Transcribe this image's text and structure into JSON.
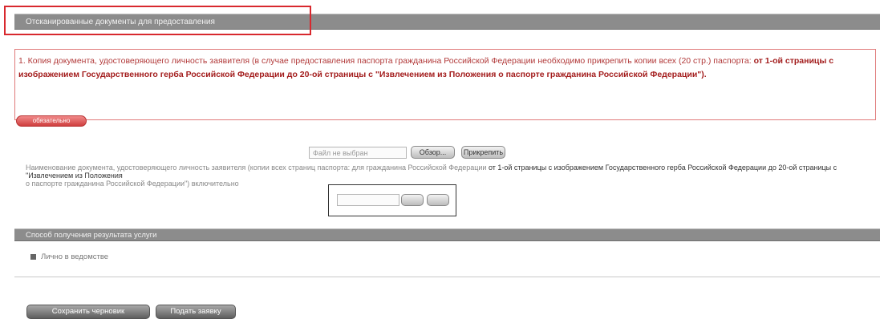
{
  "section1": {
    "title": "Отсканированные документы для предоставления"
  },
  "notice": {
    "prefix": "1. Копия документа, удостоверяющего личность заявителя (в случае предоставления паспорта гражданина Российской Федерации необходимо прикрепить копии всех (20 стр.) паспорта:",
    "bold": "от 1-ой страницы с изображением Государственного герба Российской Федерации до 20-ой страницы с \"Извлечением из Положения о паспорте гражданина Российской Федерации\")."
  },
  "required_label": "обязательно",
  "upload1": {
    "placeholder": "Файл не выбран",
    "browse_label": "Обзор...",
    "attach_label": "Прикрепить"
  },
  "desc": {
    "line1": "Наименование документа, удостоверяющего личность заявителя (копии всех страниц паспорта: для гражданина Российской Федерации",
    "line1_bold": "от 1-ой страницы с изображением Государственного герба Российской Федерации до 20-ой страницы с \"Извлечением из Положения",
    "line2": "о паспорте гражданина Российской Федерации\") включительно"
  },
  "upload2": {
    "placeholder": "",
    "browse_label": "",
    "attach_label": ""
  },
  "section2": {
    "title": "Способ получения результата услуги"
  },
  "delivery": {
    "option_label": "Лично в ведомстве"
  },
  "actions": {
    "save_draft_label": "Сохранить черновик",
    "submit_label": "Подать заявку"
  }
}
